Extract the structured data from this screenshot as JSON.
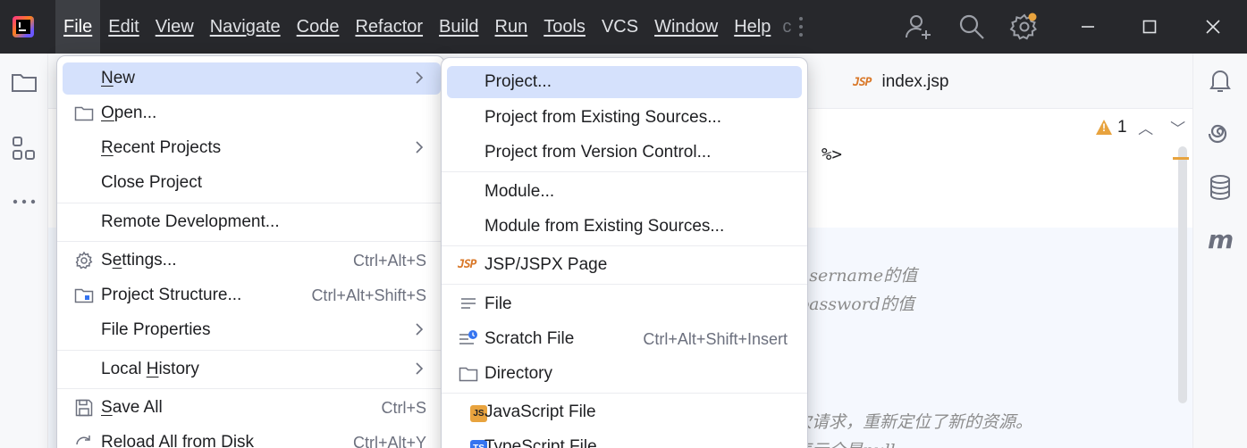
{
  "menubar": {
    "items": [
      "File",
      "Edit",
      "View",
      "Navigate",
      "Code",
      "Refactor",
      "Build",
      "Run",
      "Tools",
      "VCS",
      "Window",
      "Help"
    ],
    "overflow": "c"
  },
  "editor": {
    "tab_label": "index.jsp",
    "tab_icon_text": "JSP",
    "warning_count": "1",
    "code_fragment": "%>",
    "comments": [
      "数username的值",
      "数password的值",
      "次请求，重新定位了新的资源。",
      "表示全是null"
    ]
  },
  "file_menu": {
    "items": [
      {
        "label": "New",
        "mnemonic_index": 0,
        "icon": "",
        "shortcut": "",
        "submenu": true,
        "highlighted": true
      },
      {
        "label": "Open...",
        "mnemonic_index": 0,
        "icon": "folder-icon",
        "shortcut": "",
        "submenu": false
      },
      {
        "label": "Recent Projects",
        "mnemonic_index": 0,
        "icon": "",
        "shortcut": "",
        "submenu": true
      },
      {
        "label": "Close Project",
        "mnemonic_index": -1,
        "icon": "",
        "shortcut": "",
        "submenu": false
      },
      {
        "label": "Remote Development...",
        "mnemonic_index": -1,
        "icon": "",
        "shortcut": "",
        "submenu": false
      },
      {
        "label": "Settings...",
        "mnemonic_index": 1,
        "icon": "gear-icon",
        "shortcut": "Ctrl+Alt+S",
        "submenu": false
      },
      {
        "label": "Project Structure...",
        "mnemonic_index": -1,
        "icon": "project-structure-icon",
        "shortcut": "Ctrl+Alt+Shift+S",
        "submenu": false
      },
      {
        "label": "File Properties",
        "mnemonic_index": -1,
        "icon": "",
        "shortcut": "",
        "submenu": true
      },
      {
        "label": "Local History",
        "mnemonic_index": 6,
        "icon": "",
        "shortcut": "",
        "submenu": true
      },
      {
        "label": "Save All",
        "mnemonic_index": 0,
        "icon": "save-icon",
        "shortcut": "Ctrl+S",
        "submenu": false
      },
      {
        "label": "Reload All from Disk",
        "mnemonic_index": -1,
        "icon": "reload-icon",
        "shortcut": "Ctrl+Alt+Y",
        "submenu": false
      }
    ]
  },
  "new_menu": {
    "items": [
      {
        "label": "Project...",
        "icon": "",
        "shortcut": "",
        "highlighted": true
      },
      {
        "label": "Project from Existing Sources...",
        "icon": "",
        "shortcut": ""
      },
      {
        "label": "Project from Version Control...",
        "icon": "",
        "shortcut": ""
      },
      {
        "label": "Module...",
        "icon": "",
        "shortcut": ""
      },
      {
        "label": "Module from Existing Sources...",
        "icon": "",
        "shortcut": ""
      },
      {
        "label": "JSP/JSPX Page",
        "icon": "jsp-file-icon",
        "icon_text": "JSP",
        "shortcut": ""
      },
      {
        "label": "File",
        "icon": "text-file-icon",
        "shortcut": ""
      },
      {
        "label": "Scratch File",
        "icon": "scratch-file-icon",
        "shortcut": "Ctrl+Alt+Shift+Insert"
      },
      {
        "label": "Directory",
        "icon": "folder-icon",
        "shortcut": ""
      },
      {
        "label": "JavaScript File",
        "icon": "javascript-file-icon",
        "icon_text": "JS",
        "shortcut": ""
      },
      {
        "label": "TypeScript File",
        "icon": "typescript-file-icon",
        "icon_text": "TS",
        "shortcut": ""
      }
    ]
  },
  "colors": {
    "titlebar_bg": "#27282c",
    "menu_highlight": "#d5e1fc",
    "accent_orange": "#e8a33e",
    "jsp_orange": "#d97829",
    "ts_blue": "#3574f0"
  }
}
